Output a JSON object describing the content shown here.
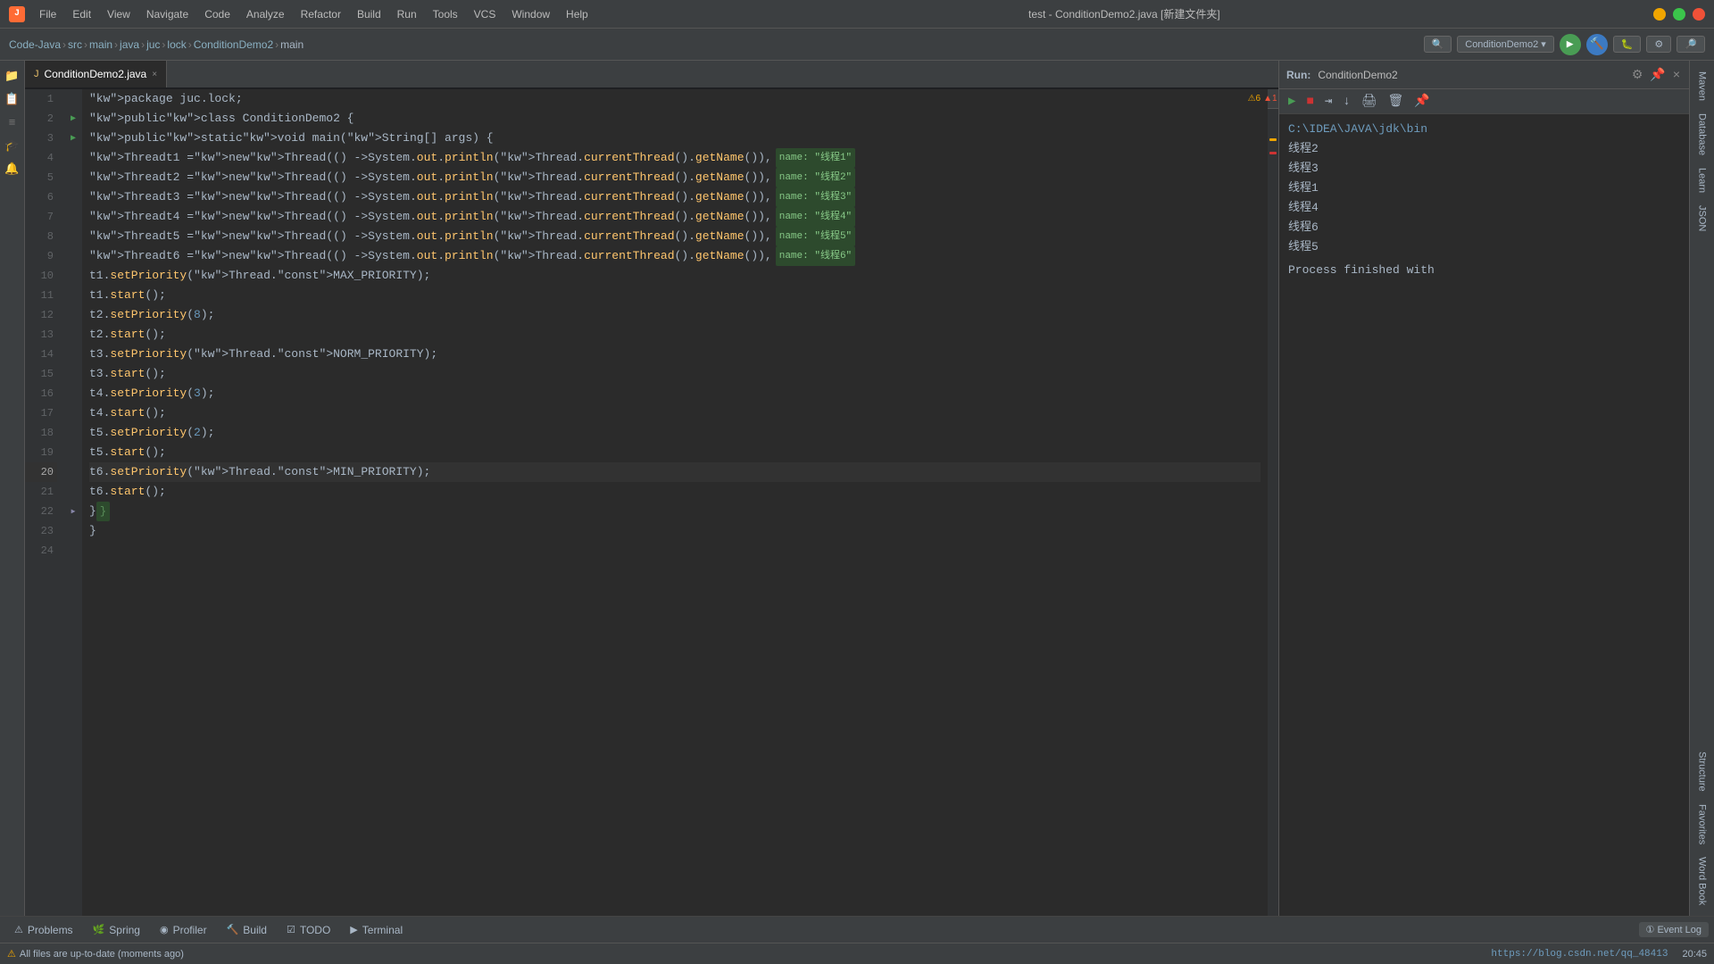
{
  "titlebar": {
    "icon_text": "J",
    "title": "test - ConditionDemo2.java [新建文件夹]",
    "menus": [
      "File",
      "Edit",
      "View",
      "Navigate",
      "Code",
      "Analyze",
      "Refactor",
      "Build",
      "Run",
      "Tools",
      "VCS",
      "Window",
      "Help"
    ]
  },
  "breadcrumb": {
    "items": [
      "Code-Java",
      "src",
      "main",
      "java",
      "juc",
      "lock",
      "ConditionDemo2",
      "main"
    ]
  },
  "navbar": {
    "run_config": "ConditionDemo2",
    "run_label": "▶",
    "build_label": "🔨"
  },
  "tabs": [
    {
      "label": "ConditionDemo2.java",
      "active": true,
      "icon": "J"
    }
  ],
  "editor": {
    "warnings": "⚠ 6",
    "errors": "▲ 1",
    "lines": [
      {
        "num": 1,
        "code": "package juc.lock;"
      },
      {
        "num": 2,
        "code": "public class ConditionDemo2 {",
        "has_run": true
      },
      {
        "num": 3,
        "code": "    public static void main(String[] args) {",
        "has_run": true,
        "is_method": true
      },
      {
        "num": 4,
        "code": "        Thread t1 = new Thread(() -> System.out.println(Thread.currentThread().getName()),",
        "hint": "name: \"线程1\""
      },
      {
        "num": 5,
        "code": "        Thread t2 = new Thread(() -> System.out.println(Thread.currentThread().getName()),",
        "hint": "name: \"线程2\""
      },
      {
        "num": 6,
        "code": "        Thread t3 = new Thread(() -> System.out.println(Thread.currentThread().getName()),",
        "hint": "name: \"线程3\""
      },
      {
        "num": 7,
        "code": "        Thread t4 = new Thread(() -> System.out.println(Thread.currentThread().getName()),",
        "hint": "name: \"线程4\""
      },
      {
        "num": 8,
        "code": "        Thread t5 = new Thread(() -> System.out.println(Thread.currentThread().getName()),",
        "hint": "name: \"线程5\""
      },
      {
        "num": 9,
        "code": "        Thread t6 = new Thread(() -> System.out.println(Thread.currentThread().getName()),",
        "hint": "name: \"线程6\""
      },
      {
        "num": 10,
        "code": "        t1.setPriority(Thread.MAX_PRIORITY);"
      },
      {
        "num": 11,
        "code": "        t1.start();"
      },
      {
        "num": 12,
        "code": "        t2.setPriority(8);"
      },
      {
        "num": 13,
        "code": "        t2.start();"
      },
      {
        "num": 14,
        "code": "        t3.setPriority(Thread.NORM_PRIORITY);"
      },
      {
        "num": 15,
        "code": "        t3.start();"
      },
      {
        "num": 16,
        "code": "        t4.setPriority(3);"
      },
      {
        "num": 17,
        "code": "        t4.start();"
      },
      {
        "num": 18,
        "code": "        t5.setPriority(2);"
      },
      {
        "num": 19,
        "code": "        t5.start();"
      },
      {
        "num": 20,
        "code": "        t6.setPriority(Thread.MIN_PRIORITY);",
        "current": true
      },
      {
        "num": 21,
        "code": "        t6.start();"
      },
      {
        "num": 22,
        "code": "    }",
        "fold": true
      },
      {
        "num": 23,
        "code": "}"
      },
      {
        "num": 24,
        "code": ""
      }
    ]
  },
  "run_panel": {
    "header_label": "Run:",
    "config_name": "ConditionDemo2",
    "console_path": "C:\\IDEA\\JAVA\\jdk\\bin",
    "output_lines": [
      "线程2",
      "线程3",
      "线程1",
      "线程4",
      "线程6",
      "线程5"
    ],
    "finished_text": "Process finished with"
  },
  "status_bar": {
    "message": "All files are up-to-date (moments ago)",
    "url": "https://blog.csdn.net/qq_48413",
    "position": "20:45"
  },
  "bottom_tabs": [
    {
      "label": "Problems",
      "icon": "⚠",
      "active": false
    },
    {
      "label": "Spring",
      "icon": "🌿",
      "active": false
    },
    {
      "label": "Profiler",
      "icon": "◉",
      "active": false
    },
    {
      "label": "Build",
      "icon": "🔨",
      "active": false
    },
    {
      "label": "TODO",
      "icon": "☑",
      "active": false
    },
    {
      "label": "Terminal",
      "icon": "▶",
      "active": false
    }
  ],
  "event_log": "① Event Log",
  "right_panels": [
    "Maven",
    "Database",
    "Learn",
    "JSON",
    "Structure",
    "Favorites",
    "Word Book"
  ]
}
